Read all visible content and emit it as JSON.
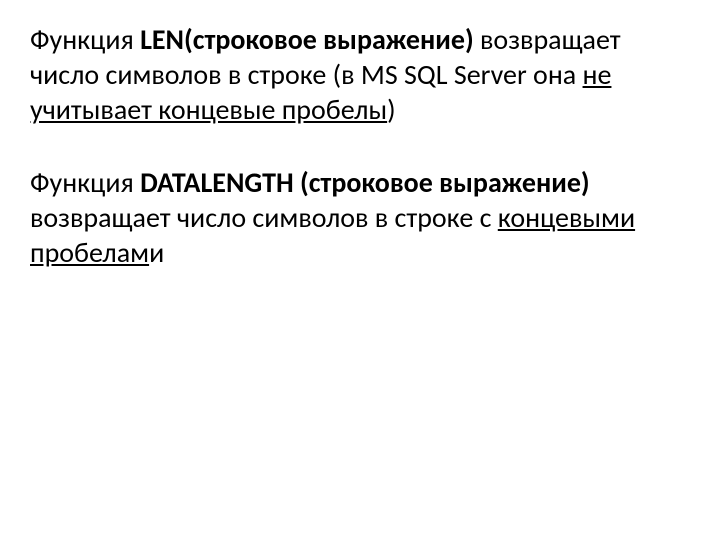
{
  "p1": {
    "t1": "Функция ",
    "t2": "LEN(строковое выражение)",
    "t3": " возвращает число символов в строке (в MS SQL Server она ",
    "t4": "не учитывает концевые пробелы",
    "t5": ")"
  },
  "p2": {
    "t1": "Функция ",
    "t2": "DATALENGTH (строковое выражение)",
    "t3": " возвращает число символов в строке с ",
    "t4": "концевыми пробелам",
    "t5": "и"
  }
}
